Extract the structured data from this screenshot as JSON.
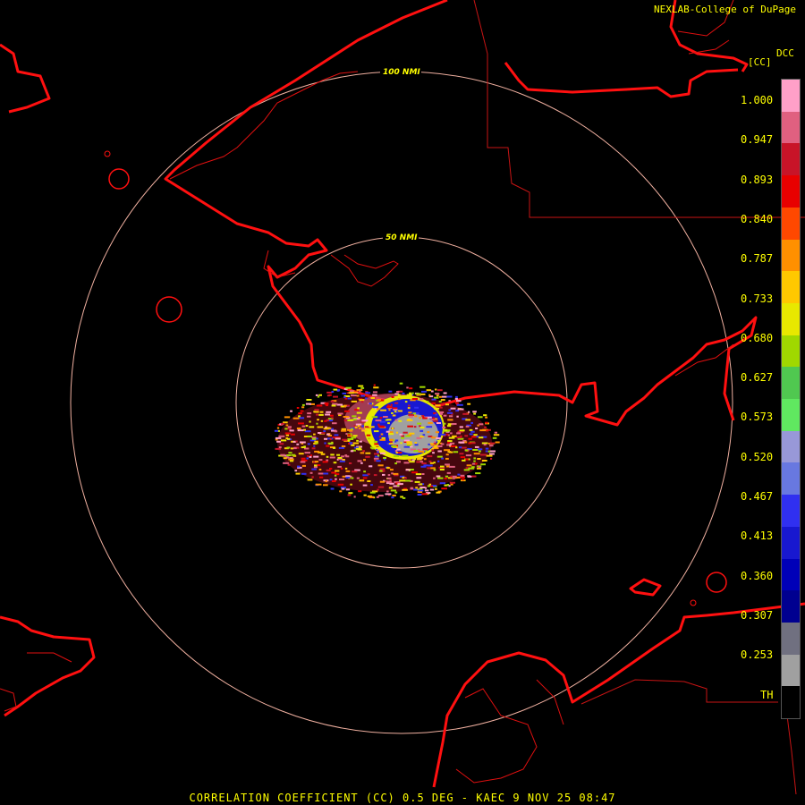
{
  "credit": "NEXLAB-College of DuPage",
  "units": {
    "product": "DCC",
    "abbrev": "[CC]"
  },
  "range_rings": [
    "100 NMI",
    "50 NMI"
  ],
  "legend": {
    "ticks": [
      "1.000",
      "0.947",
      "0.893",
      "0.840",
      "0.787",
      "0.733",
      "0.680",
      "0.627",
      "0.573",
      "0.520",
      "0.467",
      "0.413",
      "0.360",
      "0.307",
      "0.253",
      "TH"
    ],
    "colors": [
      "#ffa0c8",
      "#e06080",
      "#c81428",
      "#e80000",
      "#ff4800",
      "#ff9000",
      "#ffc800",
      "#e8e800",
      "#a0d800",
      "#50c850",
      "#60e860",
      "#9898d8",
      "#6878e0",
      "#3030f0",
      "#1818d0",
      "#0000b8",
      "#000090",
      "#707080",
      "#a0a0a0",
      "#000000"
    ]
  },
  "footer": "CORRELATION COEFFICIENT (CC) 0.5 DEG - KAEC 9 NOV 25 08:47"
}
